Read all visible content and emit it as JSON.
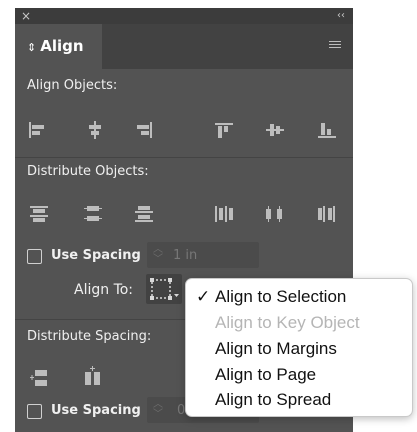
{
  "panel": {
    "close_glyph": "×",
    "collapse_glyph": "‹‹",
    "tab_arrows": "⇕",
    "tab_title": "Align"
  },
  "align_objects": {
    "label": "Align Objects:",
    "buttons": [
      "align-left-edges-icon",
      "align-horizontal-centers-icon",
      "align-right-edges-icon",
      "align-top-edges-icon",
      "align-vertical-centers-icon",
      "align-bottom-edges-icon"
    ]
  },
  "distribute_objects": {
    "label": "Distribute Objects:",
    "buttons": [
      "distribute-top-edges-icon",
      "distribute-vertical-centers-icon",
      "distribute-bottom-edges-icon",
      "distribute-left-edges-icon",
      "distribute-horizontal-centers-icon",
      "distribute-right-edges-icon"
    ],
    "use_spacing_label": "Use Spacing",
    "spacing_value": "1 in",
    "align_to_label": "Align To:"
  },
  "distribute_spacing": {
    "label": "Distribute Spacing:",
    "use_spacing_label": "Use Spacing",
    "spacing_value": "0"
  },
  "dropdown": {
    "check_glyph": "✓",
    "items": [
      {
        "label": "Align to Selection",
        "checked": true,
        "disabled": false
      },
      {
        "label": "Align to Key Object",
        "checked": false,
        "disabled": true
      },
      {
        "label": "Align to Margins",
        "checked": false,
        "disabled": false
      },
      {
        "label": "Align to Page",
        "checked": false,
        "disabled": false
      },
      {
        "label": "Align to Spread",
        "checked": false,
        "disabled": false
      }
    ]
  },
  "colors": {
    "panel_bg": "#535353",
    "header_bg": "#3c3c3c",
    "icon": "#bdbdbd",
    "text": "#f0f0f0"
  }
}
